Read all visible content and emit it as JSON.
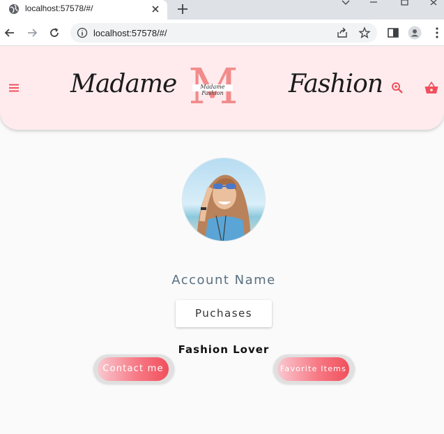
{
  "browser": {
    "tab_title": "localhost:57578/#/",
    "url": "localhost:57578/#/"
  },
  "header": {
    "left_word": "Madame",
    "right_word": "Fashion",
    "logo_letter": "M",
    "logo_small_text": "Madame Fashion"
  },
  "profile": {
    "account_name": "Account Name",
    "purchases_label": "Puchases",
    "tagline": "Fashion Lover",
    "contact_label": "Contact me",
    "favorites_label": "Favorite Items"
  },
  "colors": {
    "header_bg": "#ffebee",
    "accent": "#f0505c",
    "page_bg": "#fafafa"
  }
}
